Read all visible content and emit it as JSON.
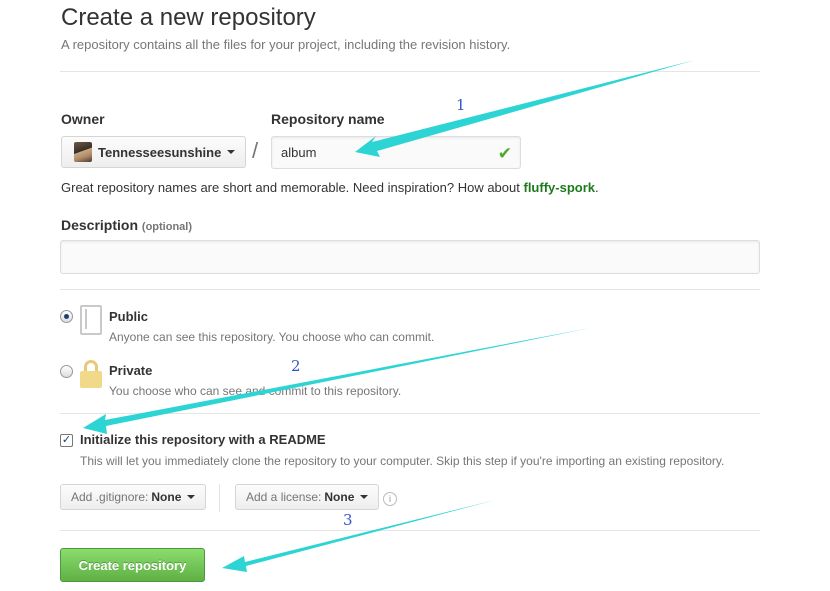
{
  "header": {
    "title": "Create a new repository",
    "subtitle": "A repository contains all the files for your project, including the revision history."
  },
  "owner": {
    "label": "Owner",
    "value": "Tennesseesunshine"
  },
  "repo_name": {
    "label": "Repository name",
    "value": "album"
  },
  "name_hint": {
    "text": "Great repository names are short and memorable. Need inspiration? How about",
    "suggestion": "fluffy-spork",
    "period": "."
  },
  "description": {
    "label": "Description",
    "optional": "(optional)",
    "value": ""
  },
  "visibility": {
    "public": {
      "title": "Public",
      "desc": "Anyone can see this repository. You choose who can commit.",
      "selected": true
    },
    "private": {
      "title": "Private",
      "desc": "You choose who can see and commit to this repository.",
      "selected": false
    }
  },
  "readme": {
    "label": "Initialize this repository with a README",
    "desc": "This will let you immediately clone the repository to your computer. Skip this step if you're importing an existing repository.",
    "checked": true
  },
  "gitignore": {
    "prefix": "Add .gitignore:",
    "value": "None"
  },
  "license": {
    "prefix": "Add a license:",
    "value": "None"
  },
  "submit": {
    "label": "Create repository"
  },
  "annotations": [
    "1",
    "2",
    "3"
  ],
  "colors": {
    "arrow": "#2dd4d4",
    "submit": "#60b044",
    "suggestion": "#1e7a1e",
    "check": "#55a532"
  }
}
